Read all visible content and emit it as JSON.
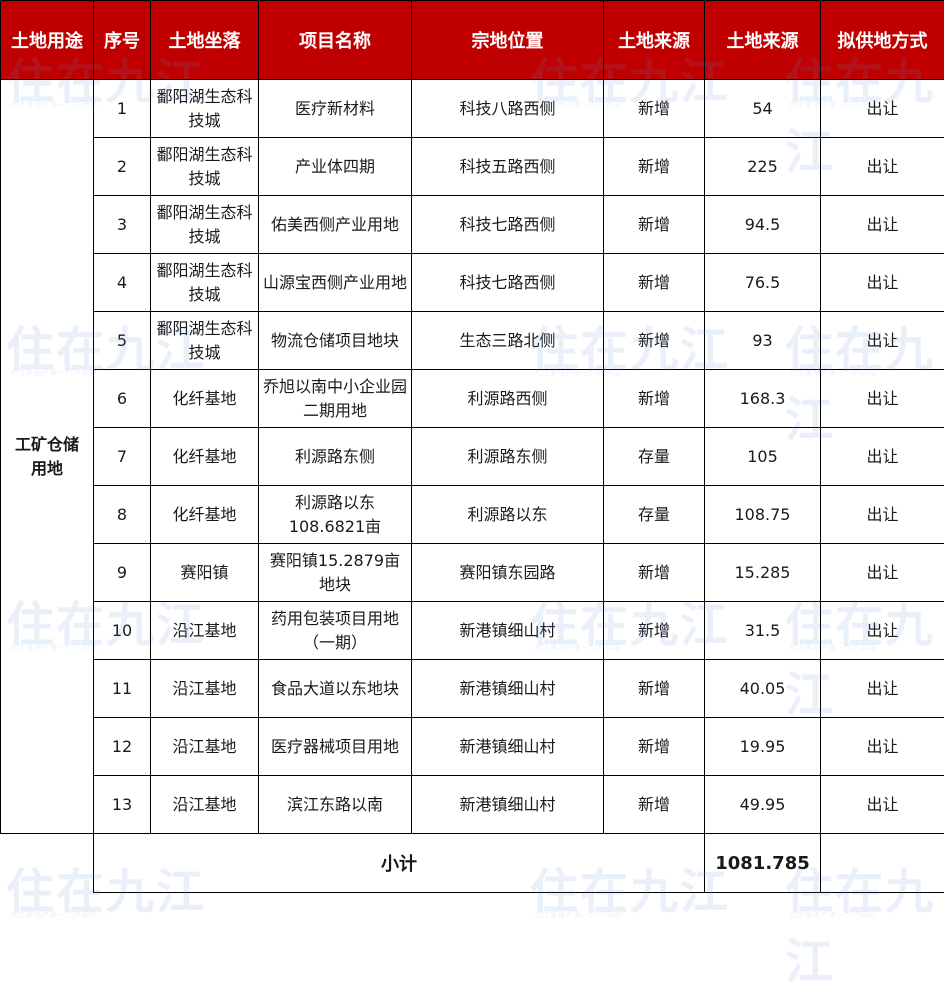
{
  "headers": [
    "土地用途",
    "序号",
    "土地坐落",
    "项目名称",
    "宗地位置",
    "土地来源",
    "土地来源",
    "拟供地方式"
  ],
  "land_use": "工矿仓储\n用地",
  "rows": [
    {
      "seq": "1",
      "location": "鄱阳湖生态科技城",
      "project": "医疗新材料",
      "parcel": "科技八路西侧",
      "source": "新增",
      "area": "54",
      "supply": "出让"
    },
    {
      "seq": "2",
      "location": "鄱阳湖生态科技城",
      "project": "产业体四期",
      "parcel": "科技五路西侧",
      "source": "新增",
      "area": "225",
      "supply": "出让"
    },
    {
      "seq": "3",
      "location": "鄱阳湖生态科技城",
      "project": "佑美西侧产业用地",
      "parcel": "科技七路西侧",
      "source": "新增",
      "area": "94.5",
      "supply": "出让"
    },
    {
      "seq": "4",
      "location": "鄱阳湖生态科技城",
      "project": "山源宝西侧产业用地",
      "parcel": "科技七路西侧",
      "source": "新增",
      "area": "76.5",
      "supply": "出让"
    },
    {
      "seq": "5",
      "location": "鄱阳湖生态科技城",
      "project": "物流仓储项目地块",
      "parcel": "生态三路北侧",
      "source": "新增",
      "area": "93",
      "supply": "出让"
    },
    {
      "seq": "6",
      "location": "化纤基地",
      "project": "乔旭以南中小企业园二期用地",
      "parcel": "利源路西侧",
      "source": "新增",
      "area": "168.3",
      "supply": "出让"
    },
    {
      "seq": "7",
      "location": "化纤基地",
      "project": "利源路东侧",
      "parcel": "利源路东侧",
      "source": "存量",
      "area": "105",
      "supply": "出让"
    },
    {
      "seq": "8",
      "location": "化纤基地",
      "project": "利源路以东108.6821亩",
      "parcel": "利源路以东",
      "source": "存量",
      "area": "108.75",
      "supply": "出让"
    },
    {
      "seq": "9",
      "location": "赛阳镇",
      "project": "赛阳镇15.2879亩地块",
      "parcel": "赛阳镇东园路",
      "source": "新增",
      "area": "15.285",
      "supply": "出让"
    },
    {
      "seq": "10",
      "location": "沿江基地",
      "project": "药用包装项目用地（一期）",
      "parcel": "新港镇细山村",
      "source": "新增",
      "area": "31.5",
      "supply": "出让"
    },
    {
      "seq": "11",
      "location": "沿江基地",
      "project": "食品大道以东地块",
      "parcel": "新港镇细山村",
      "source": "新增",
      "area": "40.05",
      "supply": "出让"
    },
    {
      "seq": "12",
      "location": "沿江基地",
      "project": "医疗器械项目用地",
      "parcel": "新港镇细山村",
      "source": "新增",
      "area": "19.95",
      "supply": "出让"
    },
    {
      "seq": "13",
      "location": "沿江基地",
      "project": "滨江东路以南",
      "parcel": "新港镇细山村",
      "source": "新增",
      "area": "49.95",
      "supply": "出让"
    }
  ],
  "subtotal": {
    "label": "小计",
    "value": "1081.785"
  },
  "watermark": {
    "logo": "住在九江",
    "tagline": "九江第地产第一门户网站"
  }
}
